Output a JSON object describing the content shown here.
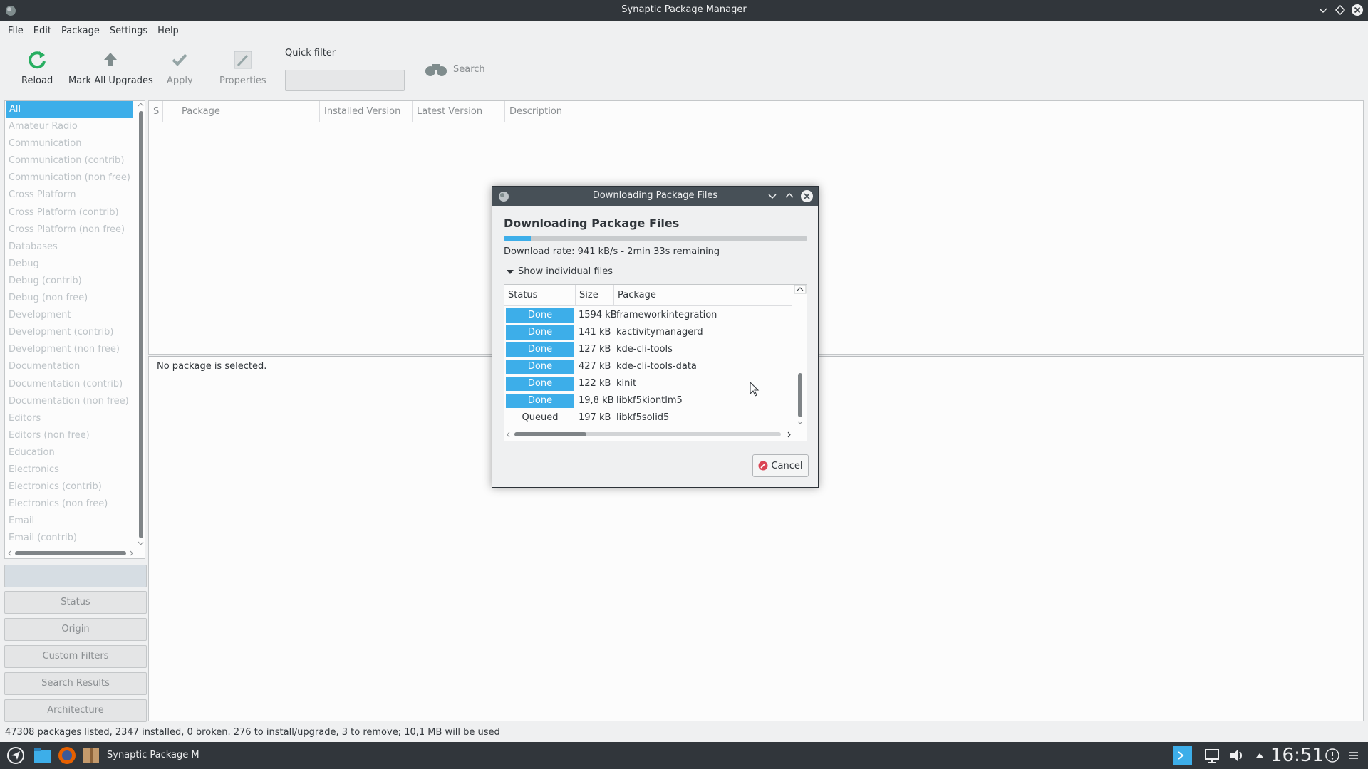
{
  "window": {
    "title": "Synaptic Package Manager"
  },
  "menu": [
    "File",
    "Edit",
    "Package",
    "Settings",
    "Help"
  ],
  "toolbar": {
    "reload": "Reload",
    "mark_all_upgrades": "Mark All Upgrades",
    "apply": "Apply",
    "properties": "Properties",
    "quick_filter_label": "Quick filter",
    "quick_filter_value": "",
    "search": "Search"
  },
  "categories": [
    "All",
    "Amateur Radio",
    "Communication",
    "Communication (contrib)",
    "Communication (non free)",
    "Cross Platform",
    "Cross Platform (contrib)",
    "Cross Platform (non free)",
    "Databases",
    "Debug",
    "Debug (contrib)",
    "Debug (non free)",
    "Development",
    "Development (contrib)",
    "Development (non free)",
    "Documentation",
    "Documentation (contrib)",
    "Documentation (non free)",
    "Editors",
    "Editors (non free)",
    "Education",
    "Electronics",
    "Electronics (contrib)",
    "Electronics (non free)",
    "Email",
    "Email (contrib)"
  ],
  "filters": {
    "sections": "",
    "status": "Status",
    "origin": "Origin",
    "custom": "Custom Filters",
    "search_results": "Search Results",
    "architecture": "Architecture"
  },
  "package_columns": {
    "s": "S",
    "package": "Package",
    "installed": "Installed Version",
    "latest": "Latest Version",
    "description": "Description"
  },
  "details": {
    "message": "No package is selected."
  },
  "statusbar": "47308 packages listed, 2347 installed, 0 broken. 276 to install/upgrade, 3 to remove; 10,1 MB will be used",
  "taskbar": {
    "task": "Synaptic Package M",
    "clock": "16:51"
  },
  "dialog": {
    "title": "Downloading Package Files",
    "heading": "Downloading Package Files",
    "progress": 0.09,
    "rate": "Download rate: 941 kB/s - 2min 33s remaining",
    "expander": "Show individual files",
    "columns": {
      "status": "Status",
      "size": "Size",
      "package": "Package"
    },
    "files": [
      {
        "status": "Done",
        "size": "1594 kB",
        "package": "frameworkintegration"
      },
      {
        "status": "Done",
        "size": "141 kB",
        "package": "kactivitymanagerd"
      },
      {
        "status": "Done",
        "size": "127 kB",
        "package": "kde-cli-tools"
      },
      {
        "status": "Done",
        "size": "427 kB",
        "package": "kde-cli-tools-data"
      },
      {
        "status": "Done",
        "size": "122 kB",
        "package": "kinit"
      },
      {
        "status": "Done",
        "size": "19,8 kB",
        "package": "libkf5kiontlm5"
      },
      {
        "status": "Queued",
        "size": "197 kB",
        "package": "libkf5solid5"
      }
    ],
    "cancel": "Cancel"
  },
  "colors": {
    "accent": "#3daee9",
    "titlebar": "#31363b",
    "dialog_titlebar": "#475057",
    "cancel_icon": "#da4453"
  }
}
